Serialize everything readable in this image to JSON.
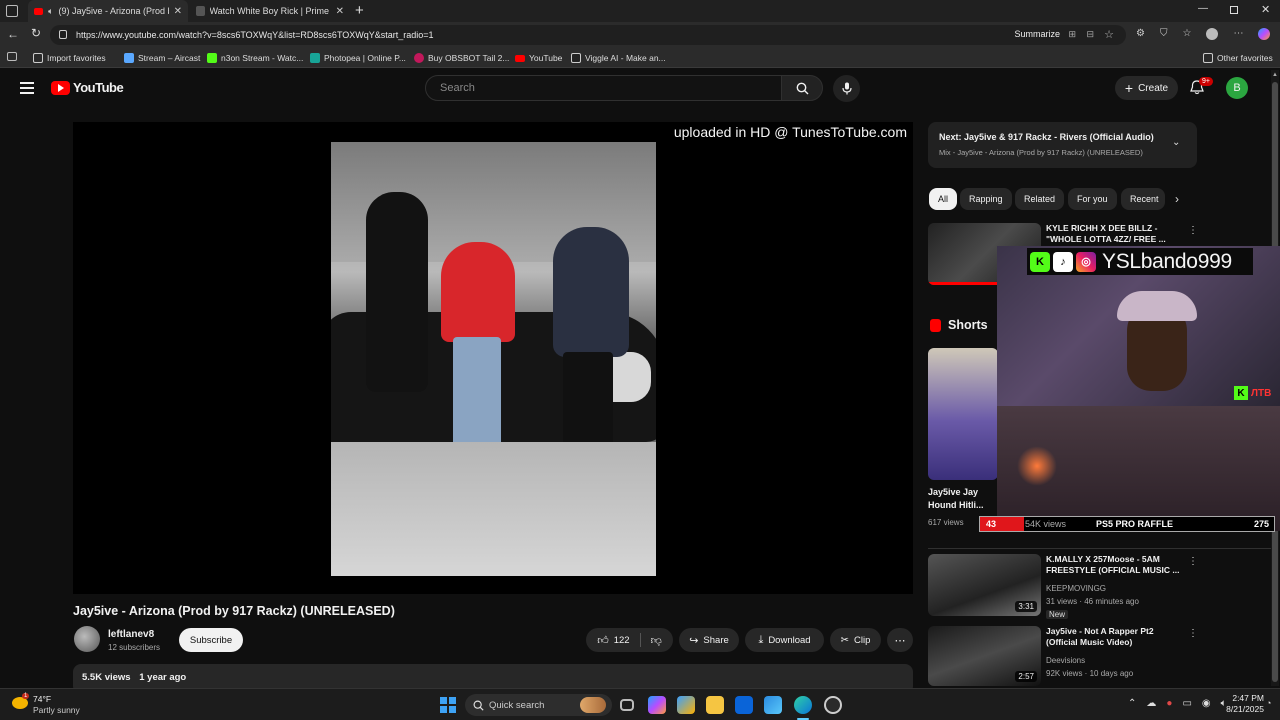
{
  "browser": {
    "tabs": [
      {
        "title": "(9) Jay5ive - Arizona (Prod b...",
        "active": true
      },
      {
        "title": "Watch White Boy Rick | Prime Vid...",
        "active": false
      }
    ],
    "url": "https://www.youtube.com/watch?v=8scs6TOXWqY&list=RD8scs6TOXWqY&start_radio=1",
    "summarize_label": "Summarize",
    "bookmarks": [
      "Import favorites",
      "Stream – Aircast",
      "n3on Stream - Watc...",
      "Photopea | Online P...",
      "Buy OBSBOT Tail 2...",
      "YouTube",
      "Viggle AI - Make an..."
    ],
    "other_favorites": "Other favorites"
  },
  "header": {
    "logo_text": "YouTube",
    "search_placeholder": "Search",
    "create_label": "Create",
    "notif_badge": "9+",
    "avatar_letter": "B"
  },
  "player": {
    "watermark": "uploaded in HD @ TunesToTube.com"
  },
  "video": {
    "title": "Jay5ive - Arizona (Prod by 917 Rackz) (UNRELEASED)",
    "channel": "leftlanev8",
    "subscribers": "12 subscribers",
    "subscribe_label": "Subscribe",
    "likes": "122",
    "share_label": "Share",
    "download_label": "Download",
    "clip_label": "Clip",
    "views": "5.5K views",
    "age": "1 year ago"
  },
  "sidebar": {
    "next_title": "Next: Jay5ive & 917 Rackz - Rivers (Official Audio)",
    "next_sub": "Mix - Jay5ive - Arizona (Prod by 917 Rackz) (UNRELEASED)",
    "chips": [
      "All",
      "Rapping",
      "Related",
      "For you",
      "Recent"
    ],
    "rec1_title": "KYLE RICHH X DEE BILLZ - \"WHOLE LOTTA 4ZZ/ FREE ...",
    "shorts_label": "Shorts",
    "short_title": "Jay5ive Jay Hound Hitli...",
    "short_views": "617 views",
    "rec2_title": "K.MALLY X 257Moose - 5AM FREESTYLE (OFFICIAL MUSIC ...",
    "rec2_channel": "KEEPMOVINGG",
    "rec2_meta": "31 views · 46 minutes ago",
    "rec2_badge": "New",
    "rec2_duration": "3:31",
    "rec3_title": "Jay5ive - Not A Rapper Pt2 (Official Music Video)",
    "rec3_channel": "Deevisions",
    "rec3_meta": "92K views · 10 days ago",
    "rec3_duration": "2:57"
  },
  "overlay": {
    "handle": "YSLbando999",
    "raffle_left": "43",
    "raffle_mid": "54K views",
    "raffle_label": "PS5 PRO RAFFLE",
    "raffle_right": "275",
    "ytb_tag": "ЛТВ"
  },
  "taskbar": {
    "temp": "74°F",
    "weather": "Partly sunny",
    "weather_badge": "1",
    "search_label": "Quick search",
    "time": "2:47 PM",
    "date": "8/21/2025"
  },
  "colors": {
    "yt_red": "#ff0000",
    "bg": "#0f0f0f",
    "chip": "#272727",
    "avatar": "#2ba640"
  }
}
